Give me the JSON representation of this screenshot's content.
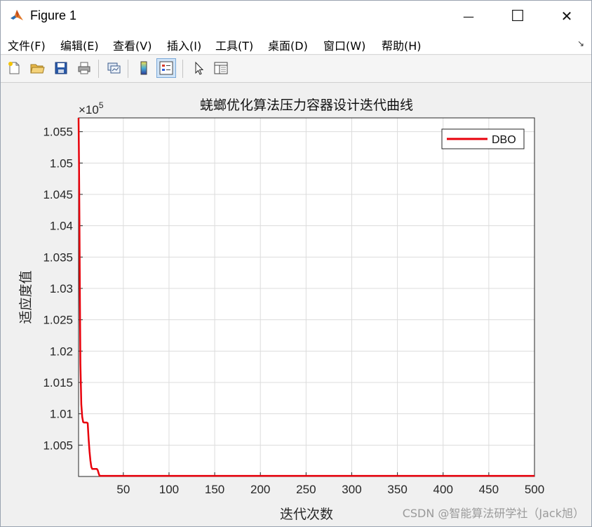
{
  "window": {
    "title": "Figure 1",
    "minimize_glyph": "—",
    "maximize_glyph": "☐",
    "close_glyph": "✕"
  },
  "menu": {
    "items": [
      "文件(F)",
      "编辑(E)",
      "查看(V)",
      "插入(I)",
      "工具(T)",
      "桌面(D)",
      "窗口(W)",
      "帮助(H)"
    ],
    "overflow_glyph": "↘"
  },
  "toolbar": {
    "icons": [
      "new-figure-icon",
      "open-file-icon",
      "save-icon",
      "print-icon",
      "link-plot-icon",
      "colorbar-icon",
      "legend-icon",
      "pointer-icon",
      "property-inspector-icon"
    ]
  },
  "colors": {
    "line": "#e8000b",
    "grid": "#dcdcdc",
    "axes": "#262626"
  },
  "watermark": "CSDN @智能算法研学社（Jack旭）",
  "chart_data": {
    "type": "line",
    "title": "蜣螂优化算法压力容器设计迭代曲线",
    "xlabel": "迭代次数",
    "ylabel": "适应度值",
    "exponent_label": "×10",
    "exponent_power": "5",
    "xlim": [
      1,
      500
    ],
    "ylim": [
      1.0,
      1.0572
    ],
    "xticks": [
      50,
      100,
      150,
      200,
      250,
      300,
      350,
      400,
      450,
      500
    ],
    "yticks": [
      1.005,
      1.01,
      1.015,
      1.02,
      1.025,
      1.03,
      1.035,
      1.04,
      1.045,
      1.05,
      1.055
    ],
    "ytick_labels": [
      "1.005",
      "1.01",
      "1.015",
      "1.02",
      "1.025",
      "1.03",
      "1.035",
      "1.04",
      "1.045",
      "1.05",
      "1.055"
    ],
    "xtick_labels": [
      "50",
      "100",
      "150",
      "200",
      "250",
      "300",
      "350",
      "400",
      "450",
      "500"
    ],
    "grid": true,
    "legend_position": "top-right",
    "series": [
      {
        "name": "DBO",
        "color": "#e8000b",
        "x": [
          1,
          1.5,
          2,
          2.5,
          3,
          4,
          5,
          6,
          7,
          8,
          9,
          10,
          11,
          12,
          13,
          14,
          15,
          16,
          17,
          18,
          19,
          20,
          21,
          22,
          23,
          24,
          25,
          30,
          40,
          60,
          100,
          200,
          300,
          400,
          500
        ],
        "y": [
          1.0572,
          1.05,
          1.04,
          1.028,
          1.018,
          1.0115,
          1.0095,
          1.0087,
          1.0086,
          1.0086,
          1.0086,
          1.0086,
          1.0085,
          1.006,
          1.004,
          1.0025,
          1.0015,
          1.0012,
          1.0012,
          1.0012,
          1.0012,
          1.0012,
          1.0012,
          1.001,
          1.0005,
          1.0001,
          1.0001,
          1.0001,
          1.0001,
          1.0001,
          1.0001,
          1.0001,
          1.0001,
          1.0001,
          1.0001
        ]
      }
    ]
  }
}
